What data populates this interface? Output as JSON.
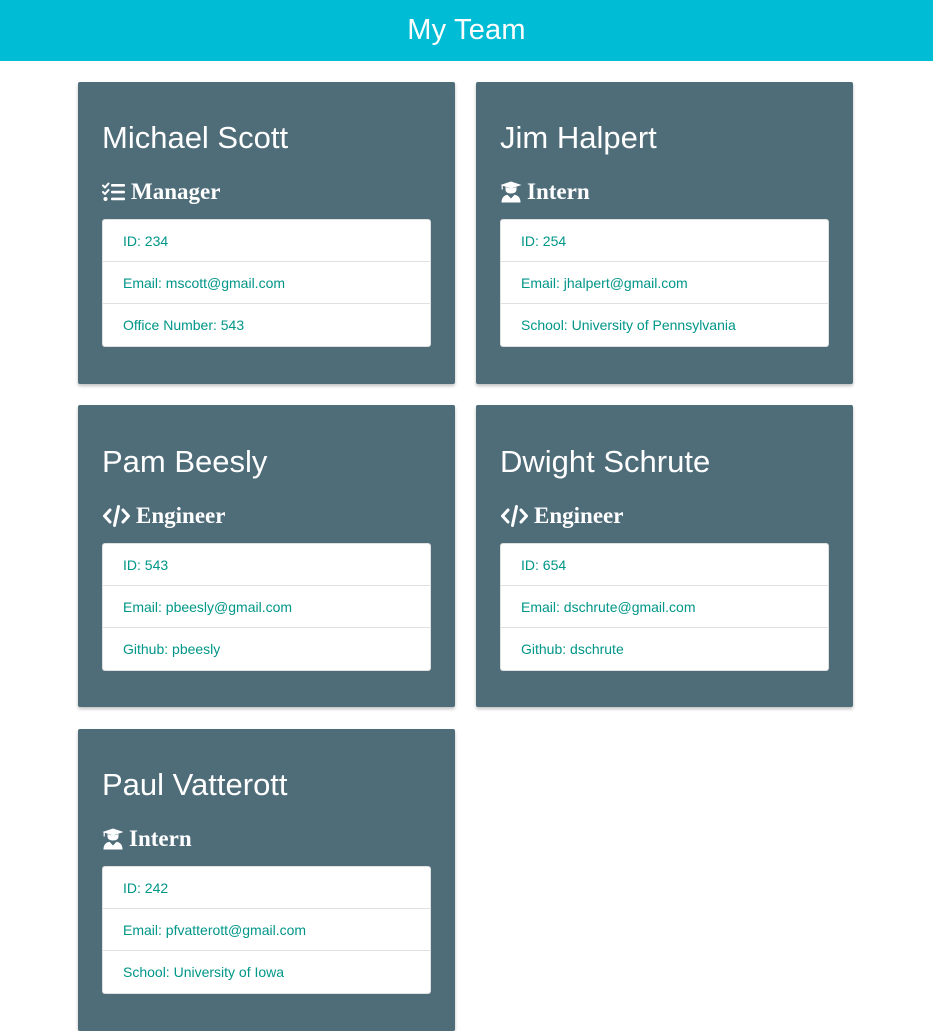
{
  "header": {
    "title": "My Team"
  },
  "colors": {
    "header_bg": "#00bcd4",
    "card_bg": "#4f6c79",
    "info_text": "#009688"
  },
  "employees": [
    {
      "name": "Michael Scott",
      "role": "Manager",
      "icon": "tasks-icon",
      "rows": [
        "ID: 234",
        "Email: mscott@gmail.com",
        "Office Number: 543"
      ]
    },
    {
      "name": "Jim Halpert",
      "role": "Intern",
      "icon": "graduate-icon",
      "rows": [
        "ID: 254",
        "Email: jhalpert@gmail.com",
        "School: University of Pennsylvania"
      ]
    },
    {
      "name": "Pam Beesly",
      "role": "Engineer",
      "icon": "code-icon",
      "rows": [
        "ID: 543",
        "Email: pbeesly@gmail.com",
        "Github: pbeesly"
      ]
    },
    {
      "name": "Dwight Schrute",
      "role": "Engineer",
      "icon": "code-icon",
      "rows": [
        "ID: 654",
        "Email: dschrute@gmail.com",
        "Github: dschrute"
      ]
    },
    {
      "name": "Paul Vatterott",
      "role": "Intern",
      "icon": "graduate-icon",
      "rows": [
        "ID: 242",
        "Email: pfvatterott@gmail.com",
        "School: University of Iowa"
      ]
    }
  ]
}
